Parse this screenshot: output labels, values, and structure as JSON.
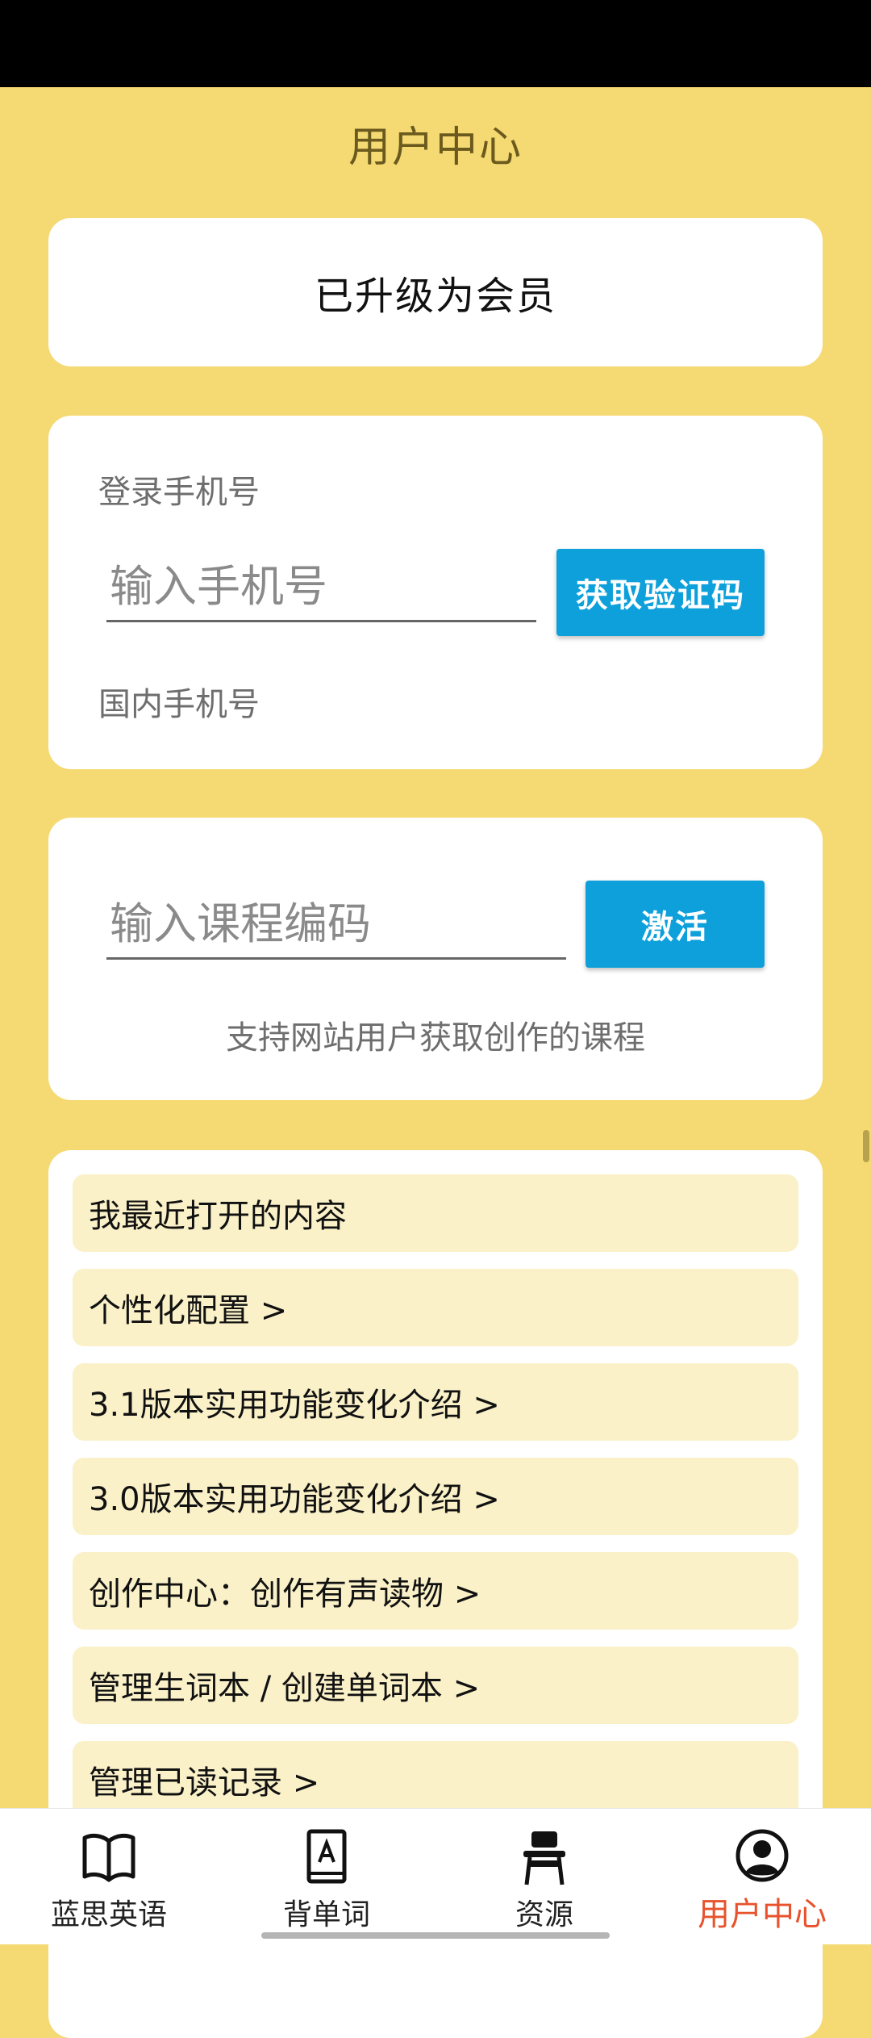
{
  "header": {
    "title": "用户中心"
  },
  "member_card": {
    "status": "已升级为会员"
  },
  "login": {
    "label": "登录手机号",
    "phone_placeholder": "输入手机号",
    "get_code_button": "获取验证码",
    "hint": "国内手机号"
  },
  "course": {
    "code_placeholder": "输入课程编码",
    "activate_button": "激活",
    "hint": "支持网站用户获取创作的课程"
  },
  "menu": {
    "items": [
      {
        "label": "我最近打开的内容"
      },
      {
        "label": "个性化配置 >"
      },
      {
        "label": "3.1版本实用功能变化介绍 >"
      },
      {
        "label": "3.0版本实用功能变化介绍 >"
      },
      {
        "label": "创作中心：创作有声读物 >"
      },
      {
        "label": "管理生词本 / 创建单词本 >"
      },
      {
        "label": "管理已读记录 >"
      }
    ]
  },
  "bottom_nav": {
    "items": [
      {
        "label": "蓝思英语",
        "icon": "book-open-icon"
      },
      {
        "label": "背单词",
        "icon": "vocab-book-icon"
      },
      {
        "label": "资源",
        "icon": "desk-chair-icon"
      },
      {
        "label": "用户中心",
        "icon": "user-circle-icon",
        "active": true
      }
    ],
    "active_color": "#e8522c"
  },
  "colors": {
    "background": "#f5d972",
    "accent_blue": "#0ea0db",
    "menu_item_bg": "#faf1c9"
  }
}
